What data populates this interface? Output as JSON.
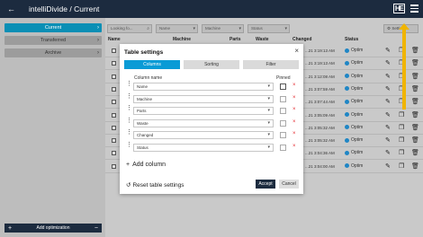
{
  "app": {
    "title": "intelliDivide / Current",
    "logo": "HE"
  },
  "sidebar": {
    "items": [
      {
        "label": "Current",
        "active": true
      },
      {
        "label": "Transferred",
        "active": false
      },
      {
        "label": "Archive",
        "active": false
      }
    ],
    "add_label": "Add optimization"
  },
  "toolbar": {
    "search_placeholder": "Looking fo...",
    "filters": [
      "Name",
      "Machine",
      "Status"
    ],
    "settings_label": "Settings"
  },
  "table": {
    "headers": [
      "Name",
      "Machine",
      "Parts",
      "Waste",
      "Changed",
      "Status"
    ],
    "rows": [
      {
        "changed": "...21 3:19:13 AM",
        "status": "Optim"
      },
      {
        "changed": "...21 3:19:13 AM",
        "status": "Optim"
      },
      {
        "changed": "...21 3:12:08 AM",
        "status": "Optim"
      },
      {
        "changed": "...21 3:07:59 AM",
        "status": "Optim"
      },
      {
        "changed": "...21 3:07:44 AM",
        "status": "Optim"
      },
      {
        "changed": "...21 3:05:09 AM",
        "status": "Optim"
      },
      {
        "changed": "...21 3:05:32 AM",
        "status": "Optim"
      },
      {
        "changed": "...21 3:05:32 AM",
        "status": "Optim"
      },
      {
        "changed": "...21 3:04:36 AM",
        "status": "Optim"
      },
      {
        "changed": "...21 3:04:00 AM",
        "status": "Optim"
      }
    ],
    "status_color": "#1f86c5"
  },
  "modal": {
    "title": "Table settings",
    "tabs": [
      {
        "label": "Columns",
        "active": true
      },
      {
        "label": "Sorting",
        "active": false
      },
      {
        "label": "Filter",
        "active": false
      }
    ],
    "col_header": "Column name",
    "pinned_header": "Pinned",
    "columns": [
      "Name",
      "Machine",
      "Parts",
      "Waste",
      "Changed",
      "Status"
    ],
    "add_column": "Add column",
    "reset": "Reset table settings",
    "accept": "Accept",
    "cancel": "Cancel"
  },
  "colors": {
    "accent": "#0a9bd6",
    "dark": "#1c2b3f",
    "delete": "#e4272d",
    "highlight_arrow": "#f0b400"
  }
}
